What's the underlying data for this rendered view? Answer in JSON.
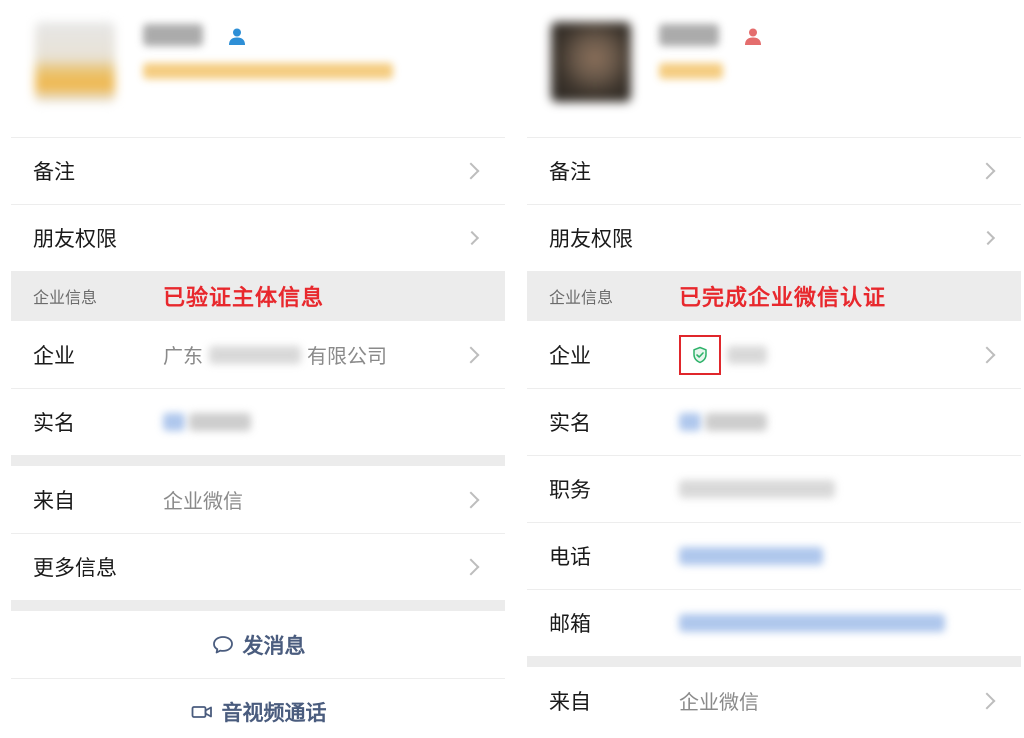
{
  "left": {
    "rows_top": [
      {
        "label": "备注"
      },
      {
        "label": "朋友权限"
      }
    ],
    "section": {
      "label": "企业信息",
      "annotation": "已验证主体信息"
    },
    "company": {
      "label": "企业",
      "prefix": "广东",
      "suffix": "有限公司"
    },
    "realname": {
      "label": "实名"
    },
    "from": {
      "label": "来自",
      "value": "企业微信"
    },
    "more": {
      "label": "更多信息"
    },
    "actions": [
      {
        "label": "发消息",
        "icon": "chat-bubble-icon"
      },
      {
        "label": "音视频通话",
        "icon": "video-camera-icon"
      }
    ]
  },
  "right": {
    "rows_top": [
      {
        "label": "备注"
      },
      {
        "label": "朋友权限"
      }
    ],
    "section": {
      "label": "企业信息",
      "annotation": "已完成企业微信认证"
    },
    "company": {
      "label": "企业",
      "icon": "shield-check-icon"
    },
    "realname": {
      "label": "实名"
    },
    "title": {
      "label": "职务"
    },
    "phone": {
      "label": "电话"
    },
    "email": {
      "label": "邮箱"
    },
    "from": {
      "label": "来自",
      "value": "企业微信"
    }
  },
  "colors": {
    "annotation_red": "#e8282d",
    "action_blue": "#4a5c7e",
    "male_icon": "#2e8fd6",
    "female_icon": "#e46d6d",
    "shield_green": "#2fb26a"
  }
}
